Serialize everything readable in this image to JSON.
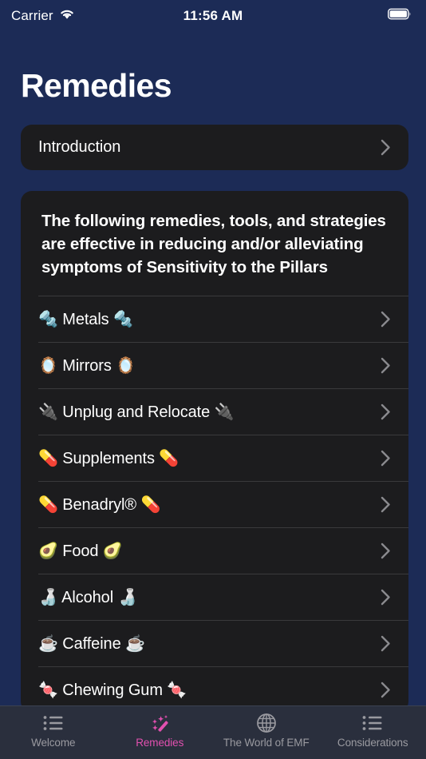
{
  "status_bar": {
    "carrier": "Carrier",
    "time": "11:56 AM",
    "wifi_icon": "wifi-icon",
    "battery_icon": "battery-full-icon"
  },
  "header": {
    "title": "Remedies"
  },
  "intro_card": {
    "label": "Introduction",
    "chevron_icon": "chevron-right-icon"
  },
  "main_card": {
    "blurb": "The following remedies, tools, and strategies are effective in reducing and/or alleviating symptoms of Sensitivity to the Pillars",
    "items": [
      {
        "label": "🔩 Metals 🔩",
        "name": "metals"
      },
      {
        "label": "🪞 Mirrors 🪞",
        "name": "mirrors"
      },
      {
        "label": "🔌 Unplug and Relocate 🔌",
        "name": "unplug-and-relocate"
      },
      {
        "label": "💊 Supplements 💊",
        "name": "supplements"
      },
      {
        "label": "💊 Benadryl® 💊",
        "name": "benadryl"
      },
      {
        "label": "🥑 Food 🥑",
        "name": "food"
      },
      {
        "label": "🍶 Alcohol 🍶",
        "name": "alcohol"
      },
      {
        "label": "☕ Caffeine ☕",
        "name": "caffeine"
      },
      {
        "label": "🍬 Chewing Gum 🍬",
        "name": "chewing-gum"
      }
    ]
  },
  "tab_bar": {
    "active_index": 1,
    "active_color": "#e250b0",
    "inactive_color": "#9a9aa0",
    "tabs": [
      {
        "label": "Welcome",
        "icon": "bulleted-list-icon"
      },
      {
        "label": "Remedies",
        "icon": "magic-wand-icon"
      },
      {
        "label": "The World of EMF",
        "icon": "globe-icon"
      },
      {
        "label": "Considerations",
        "icon": "bulleted-list-icon"
      }
    ]
  },
  "colors": {
    "page_background": "#1c2b56",
    "card_background": "#1c1c1e",
    "separator": "#3a3a3c",
    "tab_bar_background": "#2a2f3d",
    "accent": "#e250b0"
  }
}
